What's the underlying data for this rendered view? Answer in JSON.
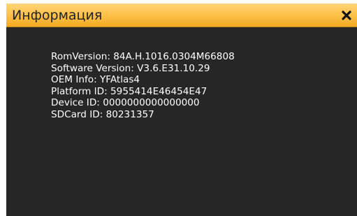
{
  "dialog": {
    "title": "Информация",
    "close_icon": "close-x-icon",
    "colors": {
      "titlebar_top": "#ffd57a",
      "titlebar_bottom": "#f0a924",
      "body_bg": "#262626",
      "text": "#ffffff",
      "title_text": "#222222"
    }
  },
  "info": {
    "lines": [
      "RomVersion: 84A.H.1016.0304M66808",
      "Software Version: V3.6.E31.10.29",
      "OEM Info: YFAtlas4",
      "Platform ID: 5955414E46454E47",
      "Device ID: 0000000000000000",
      "SDCard ID: 80231357"
    ]
  }
}
